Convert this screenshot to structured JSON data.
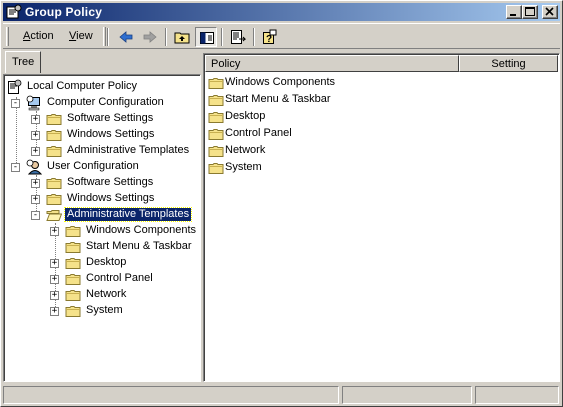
{
  "window": {
    "title": "Group Policy"
  },
  "title_buttons": [
    "minimize-icon",
    "maximize-icon",
    "close-icon"
  ],
  "menu": [
    {
      "label": "Action",
      "accel": "A",
      "rest": "ction"
    },
    {
      "label": "View",
      "accel": "V",
      "rest": "iew"
    }
  ],
  "toolbar_icons": [
    "back-arrow-icon",
    "forward-arrow-icon",
    "up-one-level-icon",
    "show-hide-tree-icon",
    "export-list-icon",
    "help-icon"
  ],
  "tree_tab": {
    "label": "Tree"
  },
  "tree": [
    {
      "label": "Local Computer Policy",
      "icon": "policy-scroll-icon",
      "level": 0,
      "expander": ""
    },
    {
      "label": "Computer Configuration",
      "icon": "computer-icon",
      "level": 1,
      "expander": "-"
    },
    {
      "label": "Software Settings",
      "icon": "folder-icon",
      "level": 2,
      "expander": "+"
    },
    {
      "label": "Windows Settings",
      "icon": "folder-icon",
      "level": 2,
      "expander": "+"
    },
    {
      "label": "Administrative Templates",
      "icon": "folder-icon",
      "level": 2,
      "expander": "+"
    },
    {
      "label": "User Configuration",
      "icon": "user-icon",
      "level": 1,
      "expander": "-"
    },
    {
      "label": "Software Settings",
      "icon": "folder-icon",
      "level": 2,
      "expander": "+"
    },
    {
      "label": "Windows Settings",
      "icon": "folder-icon",
      "level": 2,
      "expander": "+"
    },
    {
      "label": "Administrative Templates",
      "icon": "open-folder-icon",
      "level": 2,
      "expander": "-",
      "selected": true
    },
    {
      "label": "Windows Components",
      "icon": "folder-icon",
      "level": 3,
      "expander": "+"
    },
    {
      "label": "Start Menu & Taskbar",
      "icon": "folder-icon",
      "level": 3,
      "expander": ""
    },
    {
      "label": "Desktop",
      "icon": "folder-icon",
      "level": 3,
      "expander": "+"
    },
    {
      "label": "Control Panel",
      "icon": "folder-icon",
      "level": 3,
      "expander": "+"
    },
    {
      "label": "Network",
      "icon": "folder-icon",
      "level": 3,
      "expander": "+"
    },
    {
      "label": "System",
      "icon": "folder-icon",
      "level": 3,
      "expander": "+"
    }
  ],
  "list": {
    "columns": [
      "Policy",
      "Setting"
    ],
    "rows": [
      {
        "name": "Windows Components",
        "setting": ""
      },
      {
        "name": "Start Menu & Taskbar",
        "setting": ""
      },
      {
        "name": "Desktop",
        "setting": ""
      },
      {
        "name": "Control Panel",
        "setting": ""
      },
      {
        "name": "Network",
        "setting": ""
      },
      {
        "name": "System",
        "setting": ""
      }
    ]
  },
  "colors": {
    "face": "#d4d0c8",
    "title_start": "#0a246a",
    "title_end": "#a6caf0",
    "selection": "#0a246a",
    "folder": "#f5e28a"
  }
}
